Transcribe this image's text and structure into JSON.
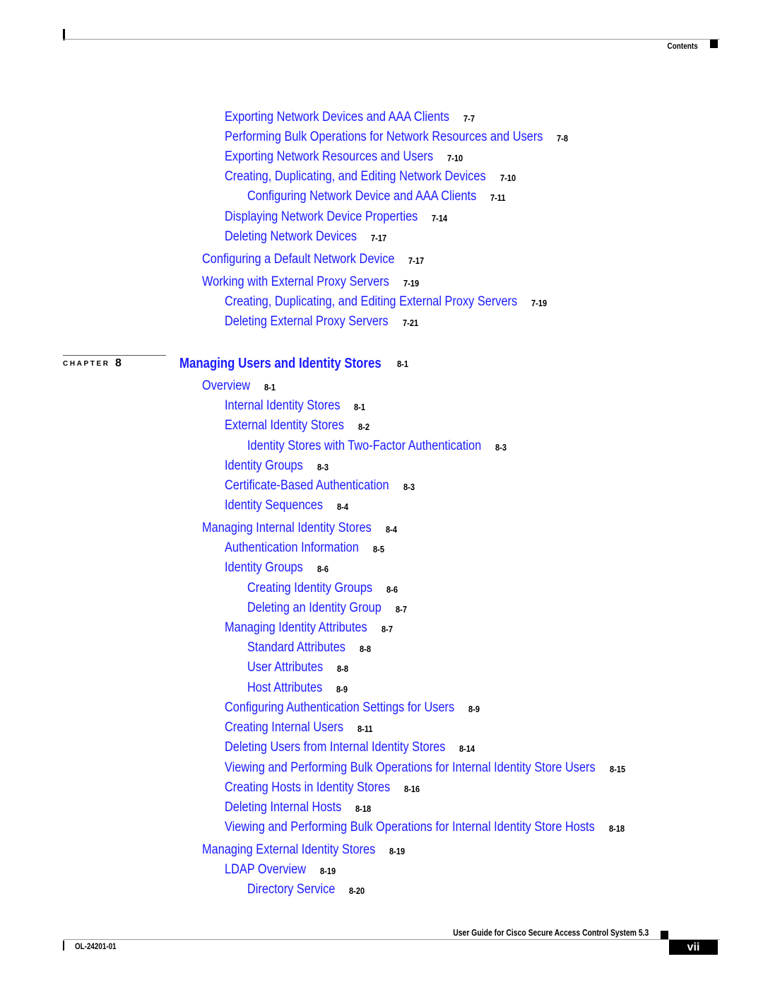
{
  "header": {
    "section_label": "Contents"
  },
  "toc_before": [
    {
      "title": "Exporting Network Devices and AAA Clients",
      "page": "7-7",
      "level": 2
    },
    {
      "title": "Performing Bulk Operations for Network Resources and Users",
      "page": "7-8",
      "level": 2
    },
    {
      "title": "Exporting Network Resources and Users",
      "page": "7-10",
      "level": 2
    },
    {
      "title": "Creating, Duplicating, and Editing Network Devices",
      "page": "7-10",
      "level": 2
    },
    {
      "title": "Configuring Network Device and AAA Clients",
      "page": "7-11",
      "level": 3
    },
    {
      "title": "Displaying Network Device Properties",
      "page": "7-14",
      "level": 2
    },
    {
      "title": "Deleting Network Devices",
      "page": "7-17",
      "level": 2
    },
    {
      "title": "Configuring a Default Network Device",
      "page": "7-17",
      "level": 1
    },
    {
      "title": "Working with External Proxy Servers",
      "page": "7-19",
      "level": 1
    },
    {
      "title": "Creating, Duplicating, and Editing External Proxy Servers",
      "page": "7-19",
      "level": 2
    },
    {
      "title": "Deleting External Proxy Servers",
      "page": "7-21",
      "level": 2
    }
  ],
  "chapter": {
    "label": "CHAPTER",
    "number": "8",
    "title": "Managing Users and Identity Stores",
    "page": "8-1"
  },
  "toc_after": [
    {
      "title": "Overview",
      "page": "8-1",
      "level": 1
    },
    {
      "title": "Internal Identity Stores",
      "page": "8-1",
      "level": 2
    },
    {
      "title": "External Identity Stores",
      "page": "8-2",
      "level": 2
    },
    {
      "title": "Identity Stores with Two-Factor Authentication",
      "page": "8-3",
      "level": 3
    },
    {
      "title": "Identity Groups",
      "page": "8-3",
      "level": 2
    },
    {
      "title": "Certificate-Based Authentication",
      "page": "8-3",
      "level": 2
    },
    {
      "title": "Identity Sequences",
      "page": "8-4",
      "level": 2
    },
    {
      "title": "Managing Internal Identity Stores",
      "page": "8-4",
      "level": 1
    },
    {
      "title": "Authentication Information",
      "page": "8-5",
      "level": 2
    },
    {
      "title": "Identity Groups",
      "page": "8-6",
      "level": 2
    },
    {
      "title": "Creating Identity Groups",
      "page": "8-6",
      "level": 3
    },
    {
      "title": "Deleting an Identity Group",
      "page": "8-7",
      "level": 3
    },
    {
      "title": "Managing Identity Attributes",
      "page": "8-7",
      "level": 2
    },
    {
      "title": "Standard Attributes",
      "page": "8-8",
      "level": 3
    },
    {
      "title": "User Attributes",
      "page": "8-8",
      "level": 3
    },
    {
      "title": "Host Attributes",
      "page": "8-9",
      "level": 3
    },
    {
      "title": "Configuring Authentication Settings for Users",
      "page": "8-9",
      "level": 2
    },
    {
      "title": "Creating Internal Users",
      "page": "8-11",
      "level": 2
    },
    {
      "title": "Deleting Users from Internal Identity Stores",
      "page": "8-14",
      "level": 2
    },
    {
      "title": "Viewing and Performing Bulk Operations for Internal Identity Store Users",
      "page": "8-15",
      "level": 2
    },
    {
      "title": "Creating Hosts in Identity Stores",
      "page": "8-16",
      "level": 2
    },
    {
      "title": "Deleting Internal Hosts",
      "page": "8-18",
      "level": 2
    },
    {
      "title": "Viewing and Performing Bulk Operations for Internal Identity Store Hosts",
      "page": "8-18",
      "level": 2
    },
    {
      "title": "Managing External Identity Stores",
      "page": "8-19",
      "level": 1
    },
    {
      "title": "LDAP Overview",
      "page": "8-19",
      "level": 2
    },
    {
      "title": "Directory Service",
      "page": "8-20",
      "level": 3
    }
  ],
  "footer": {
    "guide_title": "User Guide for Cisco Secure Access Control System 5.3",
    "doc_number": "OL-24201-01",
    "page_number": "vii"
  }
}
